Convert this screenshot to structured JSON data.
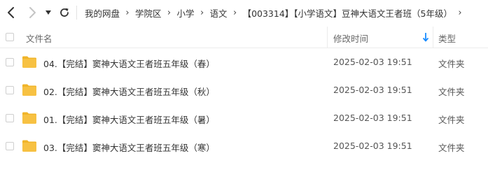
{
  "nav": {
    "back_icon": "chevron-left-icon",
    "forward_icon": "chevron-right-icon",
    "history_icon": "caret-down-icon",
    "refresh_icon": "refresh-icon"
  },
  "breadcrumb": [
    {
      "label": "我的网盘"
    },
    {
      "label": "学院区"
    },
    {
      "label": "小学"
    },
    {
      "label": "语文"
    },
    {
      "label": "【003314】【小学语文】豆神大语文王者班（5年级）"
    }
  ],
  "header": {
    "name": "文件名",
    "mtime": "修改时间",
    "type": "类型",
    "sort_icon": "sort-down-arrow-icon",
    "sort_color": "#1a8cff"
  },
  "files": [
    {
      "name": "04.【完结】窦神大语文王者班五年级（春）",
      "mtime": "2025-02-03 19:51",
      "type": "文件夹"
    },
    {
      "name": "02.【完结】窦神大语文王者班五年级（秋）",
      "mtime": "2025-02-03 19:51",
      "type": "文件夹"
    },
    {
      "name": "01.【完结】窦神大语文王者班五年级（暑）",
      "mtime": "2025-02-03 19:51",
      "type": "文件夹"
    },
    {
      "name": "03.【完结】窦神大语文王者班五年级（寒）",
      "mtime": "2025-02-03 19:51",
      "type": "文件夹"
    }
  ],
  "colors": {
    "folder": "#f7c142",
    "folder_tab": "#f0b429",
    "accent": "#1a8cff"
  }
}
